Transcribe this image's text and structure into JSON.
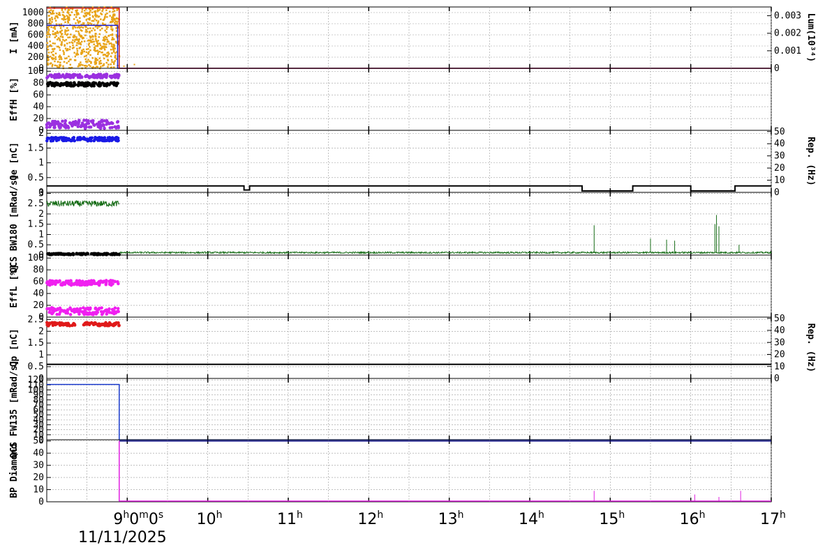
{
  "chart_data": [
    {
      "type": "scatter",
      "id": "current",
      "ylabel": "I [mA]",
      "ylim": [
        0,
        1100
      ],
      "yticks": [
        0,
        200,
        400,
        600,
        800,
        1000
      ],
      "right_ylabel": "Lum(10³⁴)",
      "right_yticks": [
        "0",
        "0.001",
        "0.002",
        "0.003"
      ],
      "series": [
        {
          "color": "#e8a317",
          "kind": "scatter",
          "value_range": [
            0,
            1100
          ],
          "x_range": [
            8.0,
            8.9
          ]
        },
        {
          "color": "#1a1acc",
          "kind": "line",
          "points": [
            [
              8.0,
              770
            ],
            [
              8.88,
              770
            ],
            [
              8.88,
              0
            ],
            [
              17.0,
              0
            ]
          ]
        },
        {
          "color": "#cc1a1a",
          "kind": "line",
          "points": [
            [
              8.0,
              1080
            ],
            [
              8.9,
              1080
            ],
            [
              8.9,
              0
            ],
            [
              17.0,
              0
            ]
          ]
        }
      ]
    },
    {
      "type": "scatter",
      "id": "effh",
      "ylabel": "EffH [%]",
      "ylim": [
        0,
        105
      ],
      "yticks": [
        0,
        20,
        40,
        60,
        80,
        100
      ],
      "series": [
        {
          "color": "#9b30e0",
          "center": 92,
          "spread": 3,
          "x_range": [
            8.0,
            8.9
          ]
        },
        {
          "color": "#000000",
          "center": 78,
          "spread": 3,
          "x_range": [
            8.0,
            8.9
          ]
        },
        {
          "color": "#9b30e0",
          "center": 10,
          "spread": 7,
          "x_range": [
            8.0,
            8.9
          ]
        }
      ]
    },
    {
      "type": "line",
      "id": "qe",
      "ylabel": "Qe [nC]",
      "ylim": [
        0,
        2.1
      ],
      "yticks": [
        0,
        0.5,
        1,
        1.5,
        2
      ],
      "ytick_labels": [
        "0",
        "0.5",
        "1",
        "1.5",
        "2"
      ],
      "right_ylabel": "Rep. (Hz)",
      "right_yticks": [
        "0",
        "10",
        "20",
        "30",
        "40",
        "50"
      ],
      "series": [
        {
          "color": "#1a1ae6",
          "kind": "scatter",
          "center": 1.8,
          "spread": 0.06,
          "x_range": [
            8.0,
            8.9
          ]
        },
        {
          "color": "#000000",
          "kind": "step",
          "points": [
            [
              8.0,
              0.22
            ],
            [
              10.45,
              0.22
            ],
            [
              10.45,
              0.08
            ],
            [
              10.52,
              0.08
            ],
            [
              10.52,
              0.22
            ],
            [
              14.65,
              0.22
            ],
            [
              14.65,
              0.05
            ],
            [
              15.28,
              0.05
            ],
            [
              15.28,
              0.22
            ],
            [
              16.0,
              0.22
            ],
            [
              16.0,
              0.05
            ],
            [
              16.55,
              0.05
            ],
            [
              16.55,
              0.22
            ],
            [
              17.0,
              0.22
            ]
          ]
        }
      ]
    },
    {
      "type": "line",
      "id": "qcs-bw180",
      "ylabel": "QCS BW180 [mRad/s]",
      "ylim": [
        0,
        3.05
      ],
      "yticks": [
        0,
        0.5,
        1,
        1.5,
        2,
        2.5,
        3
      ],
      "series": [
        {
          "color": "#146b14",
          "kind": "noise",
          "x_range": [
            8.0,
            8.9
          ],
          "center": 2.5,
          "spread": 0.15
        },
        {
          "color": "#146b14",
          "kind": "noise",
          "x_range": [
            8.9,
            17.0
          ],
          "center": 0.12,
          "spread": 0.04
        },
        {
          "color": "#000000",
          "kind": "scatter",
          "x_range": [
            8.0,
            8.9
          ],
          "center": 0.05,
          "spread": 0.03
        }
      ],
      "spikes": [
        [
          14.8,
          1.45
        ],
        [
          15.5,
          0.8
        ],
        [
          15.7,
          0.75
        ],
        [
          15.8,
          0.7
        ],
        [
          16.3,
          1.5
        ],
        [
          16.32,
          1.95
        ],
        [
          16.35,
          1.4
        ],
        [
          16.6,
          0.5
        ]
      ]
    },
    {
      "type": "scatter",
      "id": "effl",
      "ylabel": "EffL [%]",
      "ylim": [
        0,
        105
      ],
      "yticks": [
        0,
        20,
        40,
        60,
        80,
        100
      ],
      "series": [
        {
          "color": "#f020f0",
          "center": 58,
          "spread": 4,
          "x_range": [
            8.0,
            8.9
          ]
        },
        {
          "color": "#f020f0",
          "center": 10,
          "spread": 6,
          "x_range": [
            8.0,
            8.9
          ]
        }
      ]
    },
    {
      "type": "scatter",
      "id": "qp",
      "ylabel": "Qp [nC]",
      "ylim": [
        0,
        2.6
      ],
      "yticks": [
        0,
        0.5,
        1,
        1.5,
        2,
        2.5
      ],
      "right_ylabel": "Rep. (Hz)",
      "right_yticks": [
        "0",
        "10",
        "20",
        "30",
        "40",
        "50"
      ],
      "series": [
        {
          "color": "#e01a1a",
          "center": 2.3,
          "spread": 0.07,
          "x_range": [
            8.0,
            8.9
          ],
          "gap": [
            8.35,
            8.45
          ]
        },
        {
          "color": "#000000",
          "kind": "hline",
          "value": 0.6
        }
      ]
    },
    {
      "type": "line",
      "id": "qcs-fw135",
      "ylabel": "QCS FW135 [mRad/s]",
      "ylim": [
        0,
        123
      ],
      "yticks": [
        0,
        10,
        20,
        30,
        40,
        50,
        60,
        70,
        80,
        90,
        100,
        110,
        120
      ],
      "series": [
        {
          "color": "#1a3acc",
          "kind": "line",
          "points": [
            [
              8.0,
              111
            ],
            [
              8.9,
              111
            ],
            [
              8.9,
              0
            ],
            [
              17.0,
              0
            ]
          ]
        }
      ]
    },
    {
      "type": "line",
      "id": "bp-diamond",
      "ylabel": "BP Diamond",
      "ylim": [
        0,
        51
      ],
      "yticks": [
        0,
        10,
        20,
        30,
        40,
        50
      ],
      "series": [
        {
          "color": "#0a0a80",
          "kind": "line",
          "points": [
            [
              8.9,
              50
            ],
            [
              17.0,
              50
            ]
          ]
        },
        {
          "color": "#e020e0",
          "kind": "line",
          "points": [
            [
              8.9,
              50
            ],
            [
              8.9,
              0.6
            ],
            [
              17.0,
              0.6
            ]
          ]
        }
      ],
      "spikes": [
        [
          14.8,
          9
        ],
        [
          16.05,
          6
        ],
        [
          16.35,
          4
        ],
        [
          16.62,
          9
        ]
      ]
    }
  ],
  "x_axis": {
    "range": [
      8.0,
      17.0
    ],
    "ticks": [
      {
        "value": 9,
        "main": "9",
        "sup": "h",
        "extra": "0",
        "extra_sup": "m",
        "extra2": "0",
        "extra2_sup": "s"
      },
      {
        "value": 10,
        "main": "10",
        "sup": "h"
      },
      {
        "value": 11,
        "main": "11",
        "sup": "h"
      },
      {
        "value": 12,
        "main": "12",
        "sup": "h"
      },
      {
        "value": 13,
        "main": "13",
        "sup": "h"
      },
      {
        "value": 14,
        "main": "14",
        "sup": "h"
      },
      {
        "value": 15,
        "main": "15",
        "sup": "h"
      },
      {
        "value": 16,
        "main": "16",
        "sup": "h"
      },
      {
        "value": 17,
        "main": "17",
        "sup": "h"
      }
    ],
    "date": "11/11/2025"
  }
}
